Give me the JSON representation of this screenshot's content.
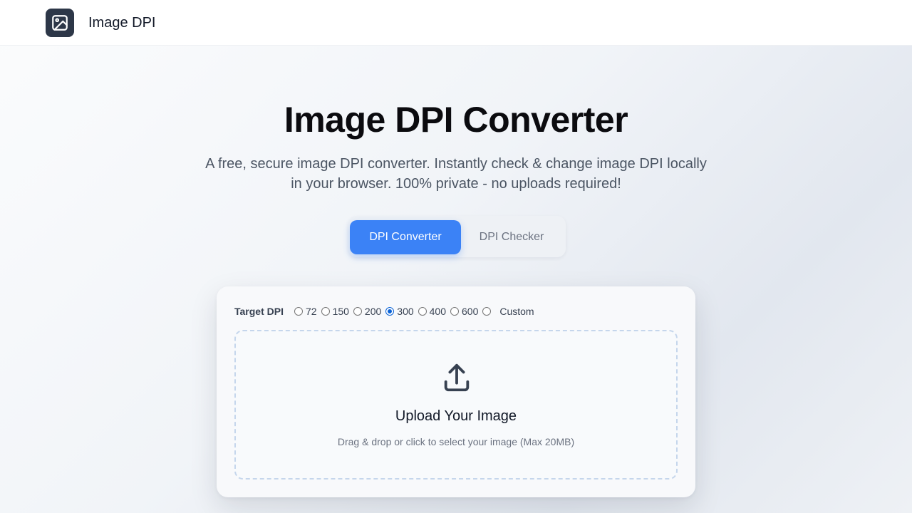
{
  "header": {
    "logo_icon": "image-icon",
    "brand": "Image DPI"
  },
  "hero": {
    "title": "Image DPI Converter",
    "subtitle_line1": "A free, secure image DPI converter. Instantly check & change image DPI locally",
    "subtitle_line2": "in your browser. 100% private - no uploads required!"
  },
  "tabs": [
    {
      "label": "DPI Converter",
      "active": true
    },
    {
      "label": "DPI Checker",
      "active": false
    }
  ],
  "converter": {
    "target_label": "Target DPI",
    "options": [
      "72",
      "150",
      "200",
      "300",
      "400",
      "600",
      "Custom"
    ],
    "selected": "300",
    "upload_icon": "upload-icon",
    "upload_title": "Upload Your Image",
    "upload_hint": "Drag & drop or click to select your image (Max 20MB)"
  },
  "colors": {
    "accent": "#3b82f6",
    "logo_bg": "#2d3748",
    "dropzone_border": "#c5d6ec"
  }
}
